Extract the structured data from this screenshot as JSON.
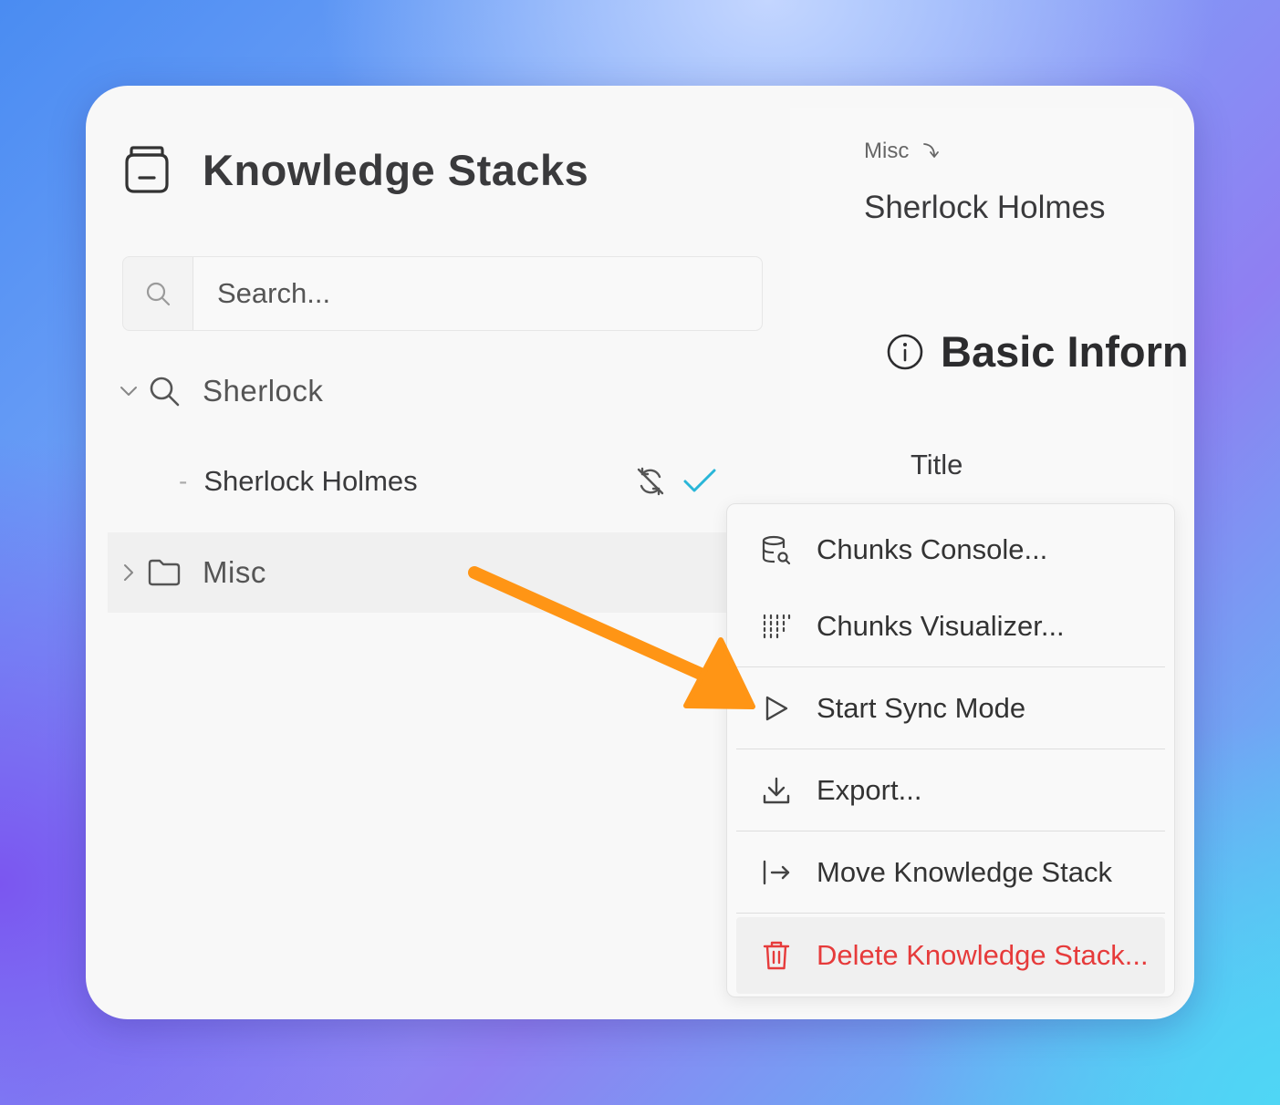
{
  "app": {
    "title": "Knowledge Stacks"
  },
  "search": {
    "placeholder": "Search..."
  },
  "tree": {
    "groups": [
      {
        "label": "Sherlock",
        "expanded": true,
        "items": [
          {
            "label": "Sherlock Holmes",
            "selected": true
          }
        ]
      },
      {
        "label": "Misc",
        "expanded": false
      }
    ]
  },
  "detail": {
    "breadcrumb": "Misc",
    "title": "Sherlock Holmes",
    "section_title": "Basic Inforn",
    "field_label": "Title"
  },
  "context_menu": {
    "items": [
      {
        "label": "Chunks Console...",
        "icon": "database-search-icon"
      },
      {
        "label": "Chunks Visualizer...",
        "icon": "grid-dots-icon"
      },
      {
        "label": "Start Sync Mode",
        "icon": "play-icon"
      },
      {
        "label": "Export...",
        "icon": "download-icon"
      },
      {
        "label": "Move Knowledge Stack",
        "icon": "move-arrow-icon"
      },
      {
        "label": "Delete Knowledge Stack...",
        "icon": "trash-icon",
        "danger": true
      }
    ]
  },
  "colors": {
    "accent_check": "#29b6d8",
    "danger": "#e63b3b",
    "annotation_arrow": "#ff9515"
  }
}
